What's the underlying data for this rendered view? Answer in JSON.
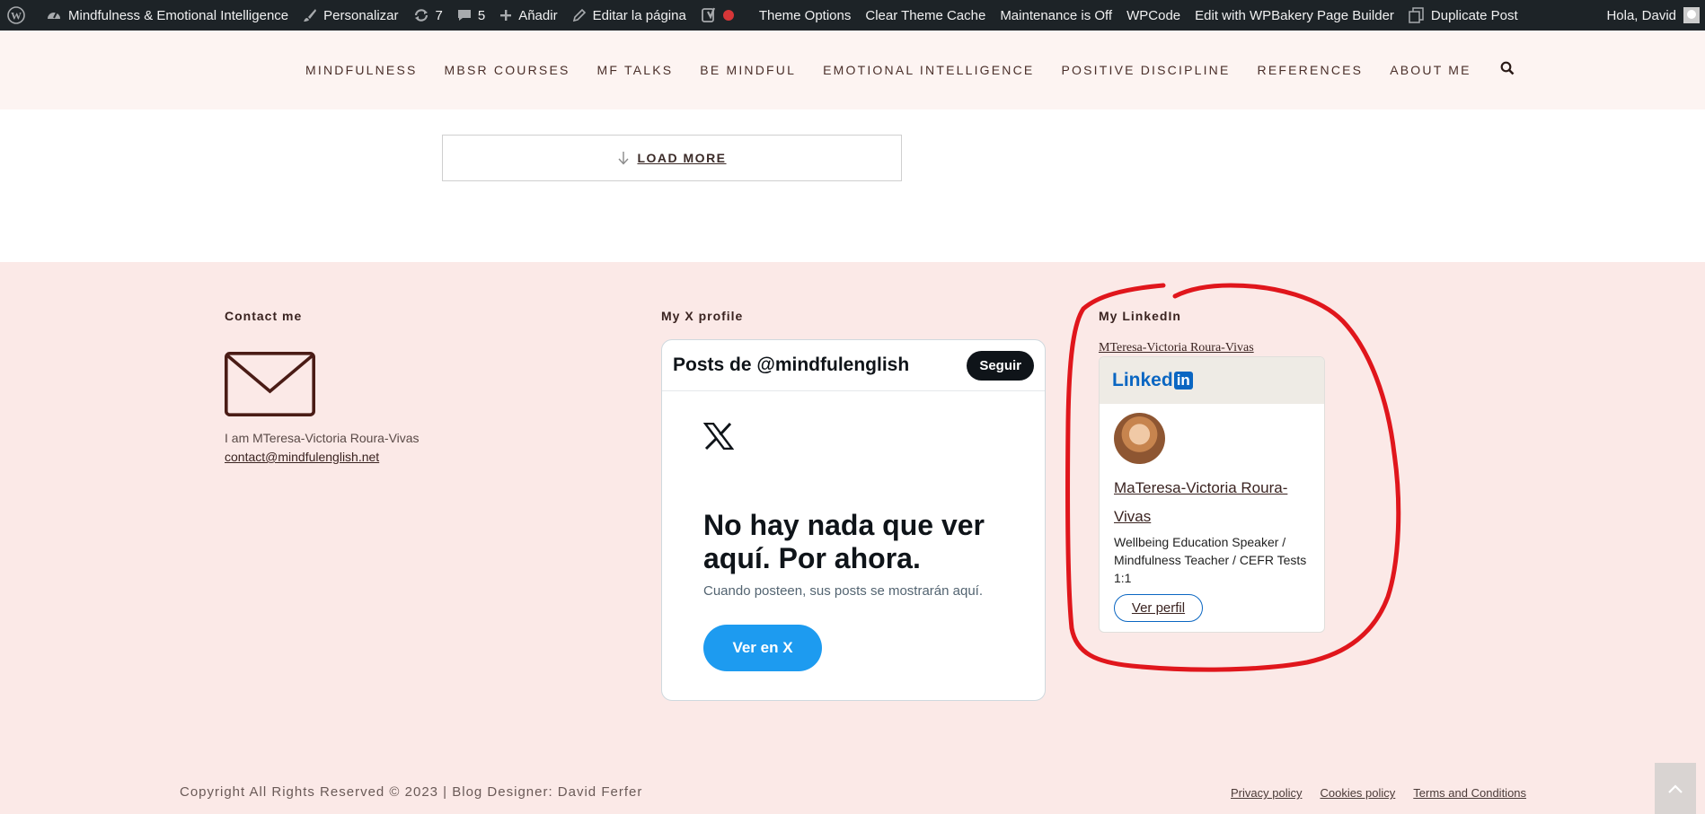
{
  "adminbar": {
    "site_name": "Mindfulness & Emotional Intelligence",
    "customize": "Personalizar",
    "updates_count": "7",
    "comments_count": "5",
    "add_new": "Añadir",
    "edit_page": "Editar la página",
    "theme_options": "Theme Options",
    "clear_cache": "Clear Theme Cache",
    "maintenance": "Maintenance is Off",
    "wpcode": "WPCode",
    "wpbakery": "Edit with WPBakery Page Builder",
    "duplicate": "Duplicate Post",
    "greeting": "Hola, David"
  },
  "nav": {
    "items": [
      "MINDFULNESS",
      "MBSR COURSES",
      "MF TALKS",
      "BE MINDFUL",
      "EMOTIONAL INTELLIGENCE",
      "POSITIVE DISCIPLINE",
      "REFERENCES",
      "ABOUT ME"
    ]
  },
  "content": {
    "load_more": "LOAD MORE"
  },
  "footer": {
    "contact": {
      "title": "Contact me",
      "intro": "I am MTeresa-Victoria Roura-Vivas",
      "email": "contact@mindfulenglish.net"
    },
    "x_profile": {
      "title": "My X profile",
      "card_title": "Posts de @mindfulenglish",
      "follow": "Seguir",
      "empty_title": "No hay nada que ver aquí. Por ahora.",
      "empty_sub": "Cuando posteen, sus posts se mostrarán aquí.",
      "view_button": "Ver en X"
    },
    "linkedin": {
      "title": "My LinkedIn",
      "profile_link": "MTeresa-Victoria Roura-Vivas",
      "logo_text": "Linked",
      "logo_in": "in",
      "person_name": "MaTeresa-Victoria Roura-Vivas",
      "headline": "Wellbeing Education Speaker / Mindfulness Teacher / CEFR Tests 1:1",
      "view_profile": "Ver perfil"
    },
    "copyright": "Copyright All Rights Reserved © 2023 | Blog Designer: David Ferfer",
    "links": [
      "Privacy policy",
      "Cookies policy",
      "Terms and Conditions"
    ]
  },
  "colors": {
    "adminbar_bg": "#1d2327",
    "header_bg": "#fdf4f2",
    "footer_bg": "#fbe9e7",
    "x_blue": "#1d9bf0",
    "linkedin_blue": "#0a66c2",
    "annotation_red": "#e0161c"
  }
}
